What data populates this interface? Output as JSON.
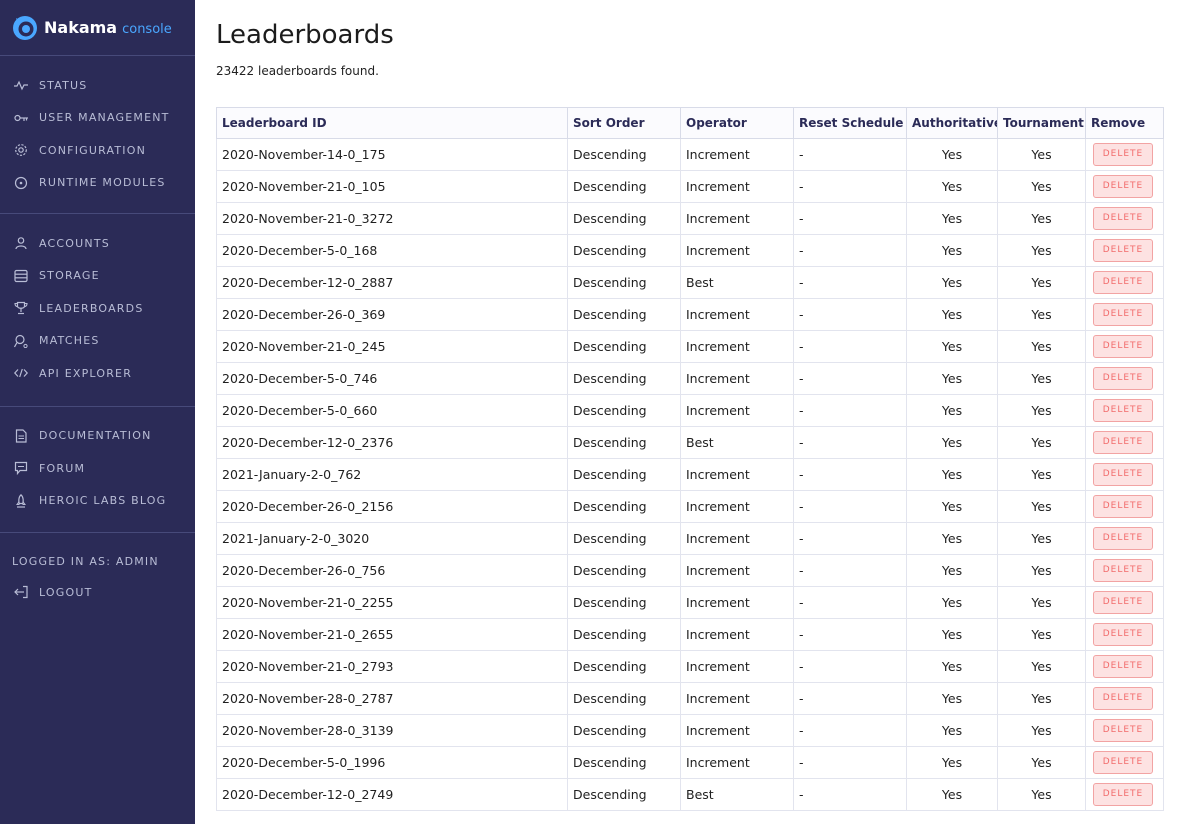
{
  "brand": {
    "name": "Nakama",
    "sub": "console"
  },
  "sidebar": {
    "sections": [
      {
        "items": [
          {
            "label": "STATUS",
            "icon": "status-icon"
          },
          {
            "label": "USER MANAGEMENT",
            "icon": "key-icon"
          },
          {
            "label": "CONFIGURATION",
            "icon": "gear-icon"
          },
          {
            "label": "RUNTIME MODULES",
            "icon": "module-icon"
          }
        ]
      },
      {
        "items": [
          {
            "label": "ACCOUNTS",
            "icon": "user-icon"
          },
          {
            "label": "STORAGE",
            "icon": "storage-icon"
          },
          {
            "label": "LEADERBOARDS",
            "icon": "trophy-icon"
          },
          {
            "label": "MATCHES",
            "icon": "matches-icon"
          },
          {
            "label": "API EXPLORER",
            "icon": "code-icon"
          }
        ]
      },
      {
        "items": [
          {
            "label": "DOCUMENTATION",
            "icon": "document-icon"
          },
          {
            "label": "FORUM",
            "icon": "chat-icon"
          },
          {
            "label": "HEROIC LABS BLOG",
            "icon": "rocket-icon"
          }
        ]
      }
    ],
    "logged_in": "LOGGED IN AS: ADMIN",
    "logout": {
      "label": "LOGOUT",
      "icon": "logout-icon"
    }
  },
  "page": {
    "title": "Leaderboards",
    "count": "23422 leaderboards found."
  },
  "table": {
    "headers": [
      "Leaderboard ID",
      "Sort Order",
      "Operator",
      "Reset Schedule",
      "Authoritative",
      "Tournament",
      "Remove"
    ],
    "delete_label": "DELETE",
    "rows": [
      {
        "id": "2020-November-14-0_175",
        "sort": "Descending",
        "op": "Increment",
        "reset": "-",
        "auth": "Yes",
        "tourn": "Yes"
      },
      {
        "id": "2020-November-21-0_105",
        "sort": "Descending",
        "op": "Increment",
        "reset": "-",
        "auth": "Yes",
        "tourn": "Yes"
      },
      {
        "id": "2020-November-21-0_3272",
        "sort": "Descending",
        "op": "Increment",
        "reset": "-",
        "auth": "Yes",
        "tourn": "Yes"
      },
      {
        "id": "2020-December-5-0_168",
        "sort": "Descending",
        "op": "Increment",
        "reset": "-",
        "auth": "Yes",
        "tourn": "Yes"
      },
      {
        "id": "2020-December-12-0_2887",
        "sort": "Descending",
        "op": "Best",
        "reset": "-",
        "auth": "Yes",
        "tourn": "Yes"
      },
      {
        "id": "2020-December-26-0_369",
        "sort": "Descending",
        "op": "Increment",
        "reset": "-",
        "auth": "Yes",
        "tourn": "Yes"
      },
      {
        "id": "2020-November-21-0_245",
        "sort": "Descending",
        "op": "Increment",
        "reset": "-",
        "auth": "Yes",
        "tourn": "Yes"
      },
      {
        "id": "2020-December-5-0_746",
        "sort": "Descending",
        "op": "Increment",
        "reset": "-",
        "auth": "Yes",
        "tourn": "Yes"
      },
      {
        "id": "2020-December-5-0_660",
        "sort": "Descending",
        "op": "Increment",
        "reset": "-",
        "auth": "Yes",
        "tourn": "Yes"
      },
      {
        "id": "2020-December-12-0_2376",
        "sort": "Descending",
        "op": "Best",
        "reset": "-",
        "auth": "Yes",
        "tourn": "Yes"
      },
      {
        "id": "2021-January-2-0_762",
        "sort": "Descending",
        "op": "Increment",
        "reset": "-",
        "auth": "Yes",
        "tourn": "Yes"
      },
      {
        "id": "2020-December-26-0_2156",
        "sort": "Descending",
        "op": "Increment",
        "reset": "-",
        "auth": "Yes",
        "tourn": "Yes"
      },
      {
        "id": "2021-January-2-0_3020",
        "sort": "Descending",
        "op": "Increment",
        "reset": "-",
        "auth": "Yes",
        "tourn": "Yes"
      },
      {
        "id": "2020-December-26-0_756",
        "sort": "Descending",
        "op": "Increment",
        "reset": "-",
        "auth": "Yes",
        "tourn": "Yes"
      },
      {
        "id": "2020-November-21-0_2255",
        "sort": "Descending",
        "op": "Increment",
        "reset": "-",
        "auth": "Yes",
        "tourn": "Yes"
      },
      {
        "id": "2020-November-21-0_2655",
        "sort": "Descending",
        "op": "Increment",
        "reset": "-",
        "auth": "Yes",
        "tourn": "Yes"
      },
      {
        "id": "2020-November-21-0_2793",
        "sort": "Descending",
        "op": "Increment",
        "reset": "-",
        "auth": "Yes",
        "tourn": "Yes"
      },
      {
        "id": "2020-November-28-0_2787",
        "sort": "Descending",
        "op": "Increment",
        "reset": "-",
        "auth": "Yes",
        "tourn": "Yes"
      },
      {
        "id": "2020-November-28-0_3139",
        "sort": "Descending",
        "op": "Increment",
        "reset": "-",
        "auth": "Yes",
        "tourn": "Yes"
      },
      {
        "id": "2020-December-5-0_1996",
        "sort": "Descending",
        "op": "Increment",
        "reset": "-",
        "auth": "Yes",
        "tourn": "Yes"
      },
      {
        "id": "2020-December-12-0_2749",
        "sort": "Descending",
        "op": "Best",
        "reset": "-",
        "auth": "Yes",
        "tourn": "Yes"
      }
    ]
  }
}
